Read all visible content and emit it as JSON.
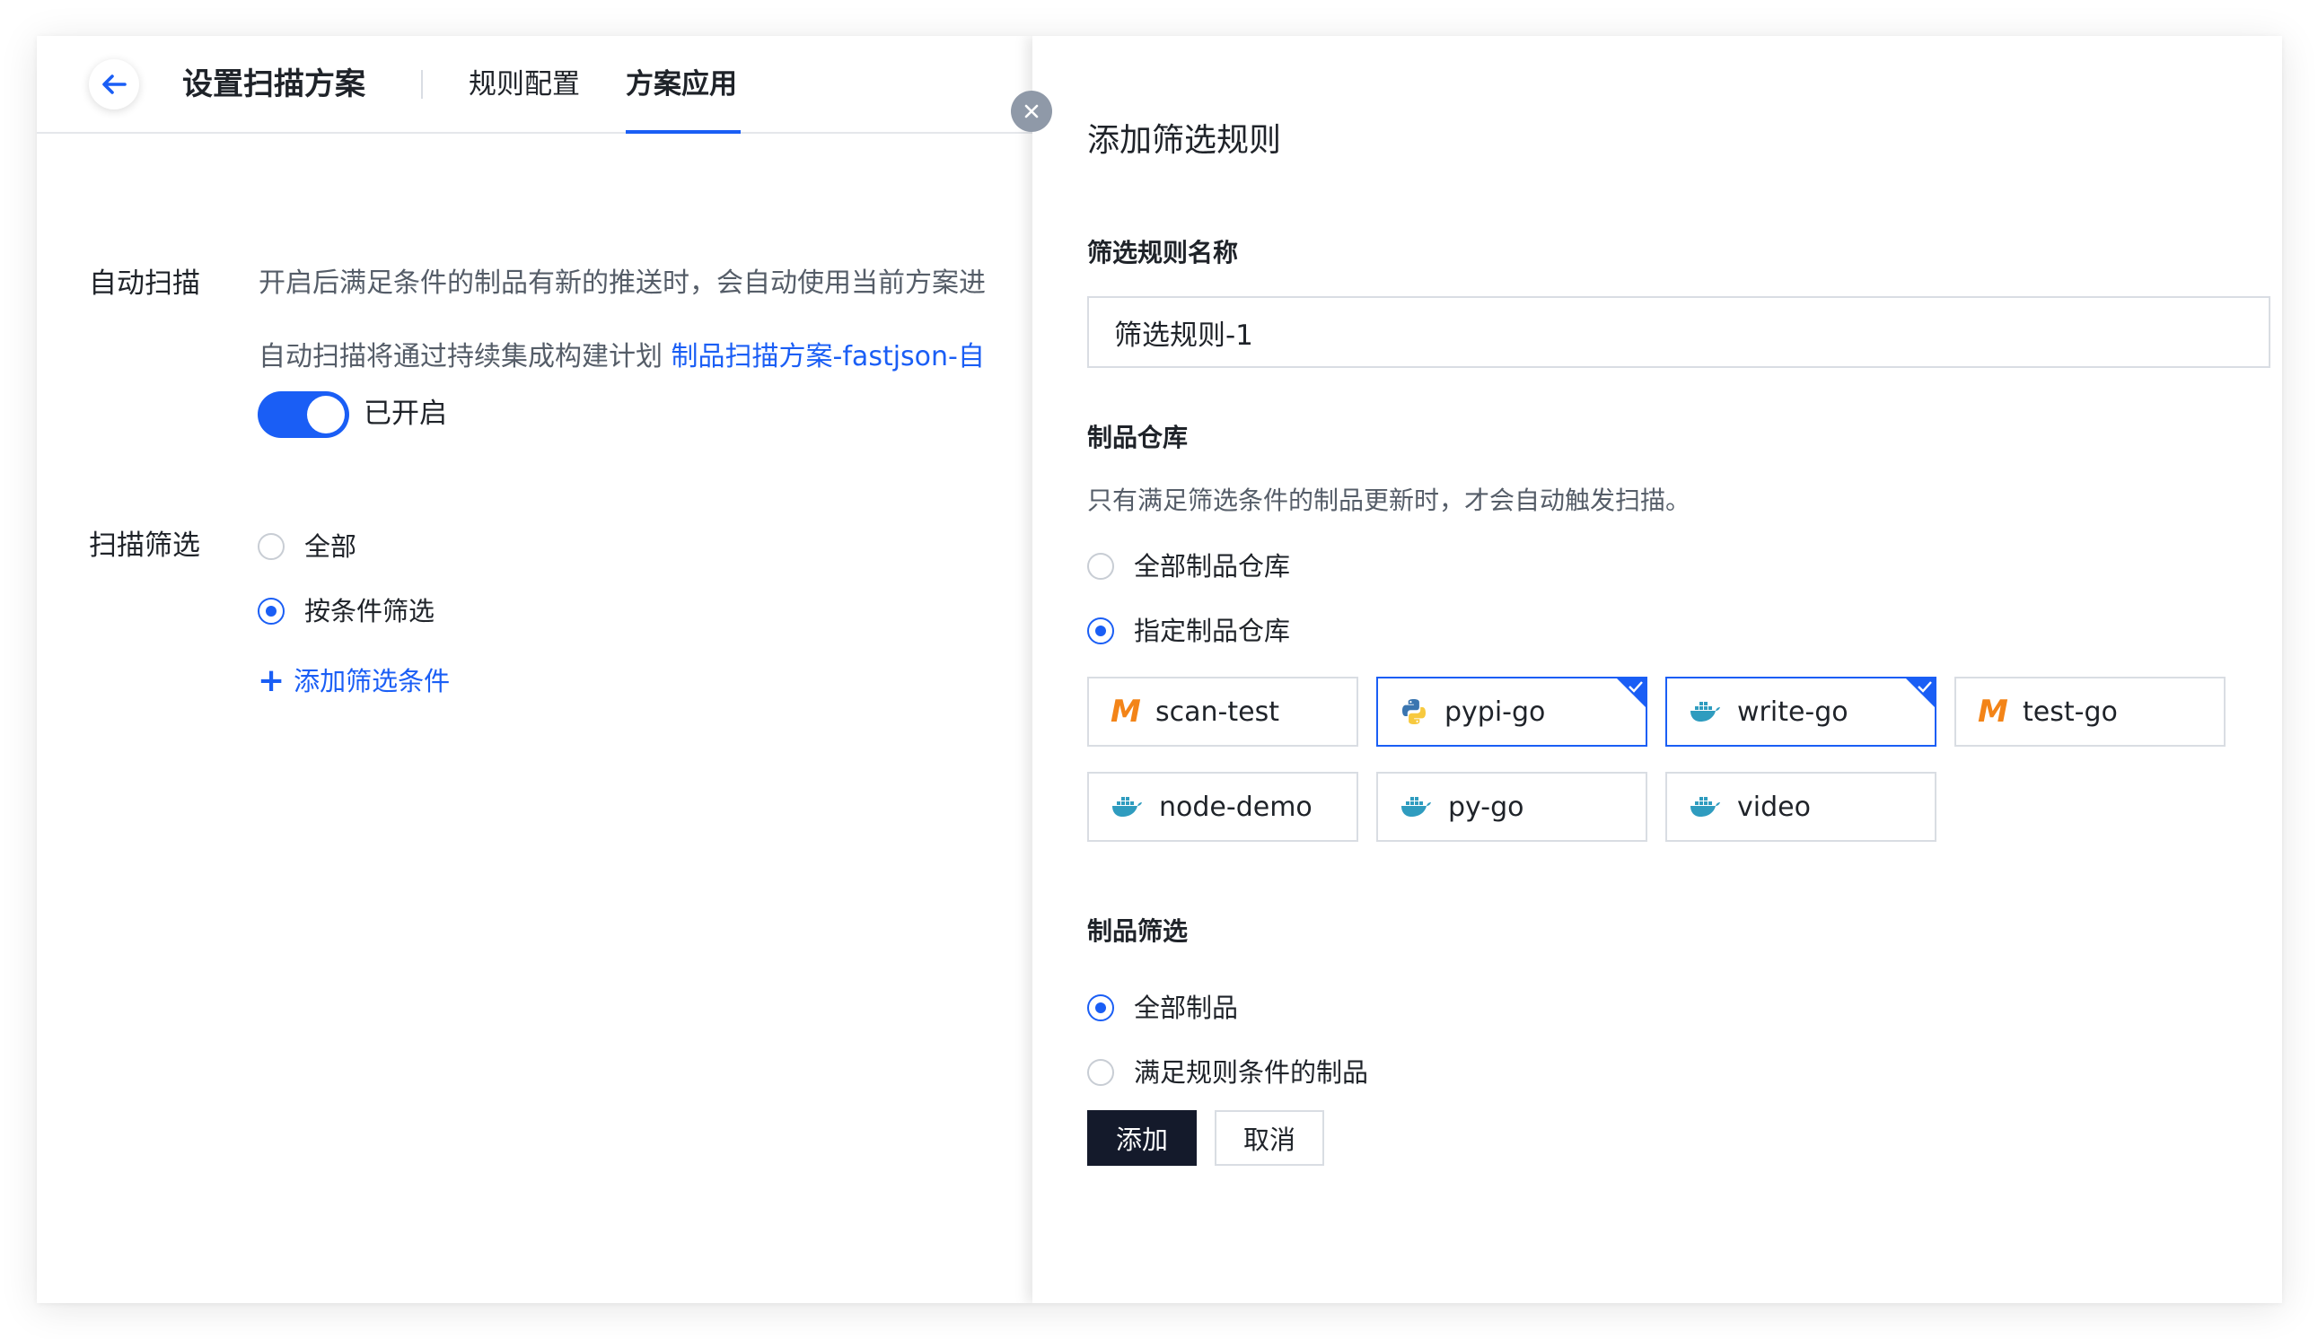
{
  "header": {
    "title": "设置扫描方案",
    "tabs": [
      {
        "label": "规则配置",
        "active": false
      },
      {
        "label": "方案应用",
        "active": true
      }
    ]
  },
  "auto_scan": {
    "label": "自动扫描",
    "desc1": "开启后满足条件的制品有新的推送时，会自动使用当前方案进",
    "desc2_prefix": "自动扫描将通过持续集成构建计划 ",
    "desc2_link": "制品扫描方案-fastjson-自",
    "switch_on": true,
    "switch_text": "已开启"
  },
  "scan_filter": {
    "label": "扫描筛选",
    "options": [
      {
        "label": "全部",
        "checked": false
      },
      {
        "label": "按条件筛选",
        "checked": true
      }
    ],
    "add_condition": "添加筛选条件"
  },
  "drawer": {
    "title": "添加筛选规则",
    "name_label": "筛选规则名称",
    "name_value": "筛选规则-1",
    "repo_label": "制品仓库",
    "repo_help": "只有满足筛选条件的制品更新时，才会自动触发扫描。",
    "repo_options": [
      {
        "label": "全部制品仓库",
        "checked": false
      },
      {
        "label": "指定制品仓库",
        "checked": true
      }
    ],
    "repos": [
      {
        "name": "scan-test",
        "icon": "maven-icon",
        "selected": false
      },
      {
        "name": "pypi-go",
        "icon": "python-icon",
        "selected": true
      },
      {
        "name": "write-go",
        "icon": "docker-icon",
        "selected": true
      },
      {
        "name": "test-go",
        "icon": "maven-icon",
        "selected": false
      },
      {
        "name": "node-demo",
        "icon": "docker-icon",
        "selected": false
      },
      {
        "name": "py-go",
        "icon": "docker-icon",
        "selected": false
      },
      {
        "name": "video",
        "icon": "docker-icon",
        "selected": false
      }
    ],
    "artifact_label": "制品筛选",
    "artifact_options": [
      {
        "label": "全部制品",
        "checked": true
      },
      {
        "label": "满足规则条件的制品",
        "checked": false
      }
    ],
    "add_button": "添加",
    "cancel_button": "取消"
  },
  "colors": {
    "accent": "#1a5ef5",
    "primary_button": "#141a2b",
    "maven": "#f38418",
    "docker": "#2f9cbf"
  }
}
